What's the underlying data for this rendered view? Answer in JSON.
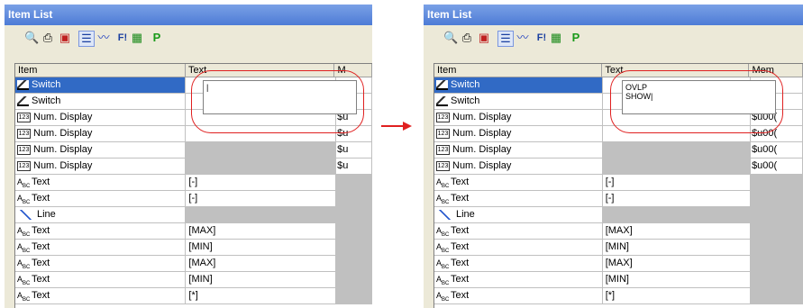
{
  "left_window": {
    "title": "Item List",
    "columns": {
      "item": "Item",
      "text": "Text",
      "memory": "M"
    },
    "edit_value": "|",
    "rows": [
      {
        "icon": "switch",
        "item": "Switch",
        "text": "",
        "memory": "",
        "selected": true
      },
      {
        "icon": "switch",
        "item": "Switch",
        "text": "",
        "memory": ""
      },
      {
        "icon": "num",
        "item": "Num. Display",
        "text": "",
        "memory": "$u"
      },
      {
        "icon": "num",
        "item": "Num. Display",
        "text": "",
        "memory": "$u"
      },
      {
        "icon": "num",
        "item": "Num. Display",
        "text": "",
        "memory": "$u"
      },
      {
        "icon": "num",
        "item": "Num. Display",
        "text": "",
        "memory": "$u"
      },
      {
        "icon": "text",
        "item": "Text",
        "text": "[-]",
        "memory": ""
      },
      {
        "icon": "text",
        "item": "Text",
        "text": "[-]",
        "memory": ""
      },
      {
        "icon": "line",
        "item": "Line",
        "text": "",
        "memory": ""
      },
      {
        "icon": "text",
        "item": "Text",
        "text": "[MAX]",
        "memory": ""
      },
      {
        "icon": "text",
        "item": "Text",
        "text": "[MIN]",
        "memory": ""
      },
      {
        "icon": "text",
        "item": "Text",
        "text": "[MAX]",
        "memory": ""
      },
      {
        "icon": "text",
        "item": "Text",
        "text": "[MIN]",
        "memory": ""
      },
      {
        "icon": "text",
        "item": "Text",
        "text": "[*]",
        "memory": ""
      }
    ]
  },
  "right_window": {
    "title": "Item List",
    "columns": {
      "item": "Item",
      "text": "Text",
      "memory": "Mem"
    },
    "edit_value_line1": "OVLP",
    "edit_value_line2": "SHOW|",
    "rows": [
      {
        "icon": "switch",
        "item": "Switch",
        "text": "",
        "memory": "",
        "selected": true
      },
      {
        "icon": "switch",
        "item": "Switch",
        "text": "",
        "memory": ""
      },
      {
        "icon": "num",
        "item": "Num. Display",
        "text": "",
        "memory": "$u00("
      },
      {
        "icon": "num",
        "item": "Num. Display",
        "text": "",
        "memory": "$u00("
      },
      {
        "icon": "num",
        "item": "Num. Display",
        "text": "",
        "memory": "$u00("
      },
      {
        "icon": "num",
        "item": "Num. Display",
        "text": "",
        "memory": "$u00("
      },
      {
        "icon": "text",
        "item": "Text",
        "text": "[-]",
        "memory": ""
      },
      {
        "icon": "text",
        "item": "Text",
        "text": "[-]",
        "memory": ""
      },
      {
        "icon": "line",
        "item": "Line",
        "text": "",
        "memory": ""
      },
      {
        "icon": "text",
        "item": "Text",
        "text": "[MAX]",
        "memory": ""
      },
      {
        "icon": "text",
        "item": "Text",
        "text": "[MIN]",
        "memory": ""
      },
      {
        "icon": "text",
        "item": "Text",
        "text": "[MAX]",
        "memory": ""
      },
      {
        "icon": "text",
        "item": "Text",
        "text": "[MIN]",
        "memory": ""
      },
      {
        "icon": "text",
        "item": "Text",
        "text": "[*]",
        "memory": ""
      }
    ]
  },
  "toolbar_icons": [
    "print-preview-icon",
    "print-icon",
    "export-icon",
    "list-view-icon",
    "wave-icon",
    "f1-icon",
    "grid-icon",
    "p-icon"
  ],
  "colors": {
    "highlight_oval": "#e02020",
    "selection": "#316ac5",
    "arrow": "#e02020"
  }
}
